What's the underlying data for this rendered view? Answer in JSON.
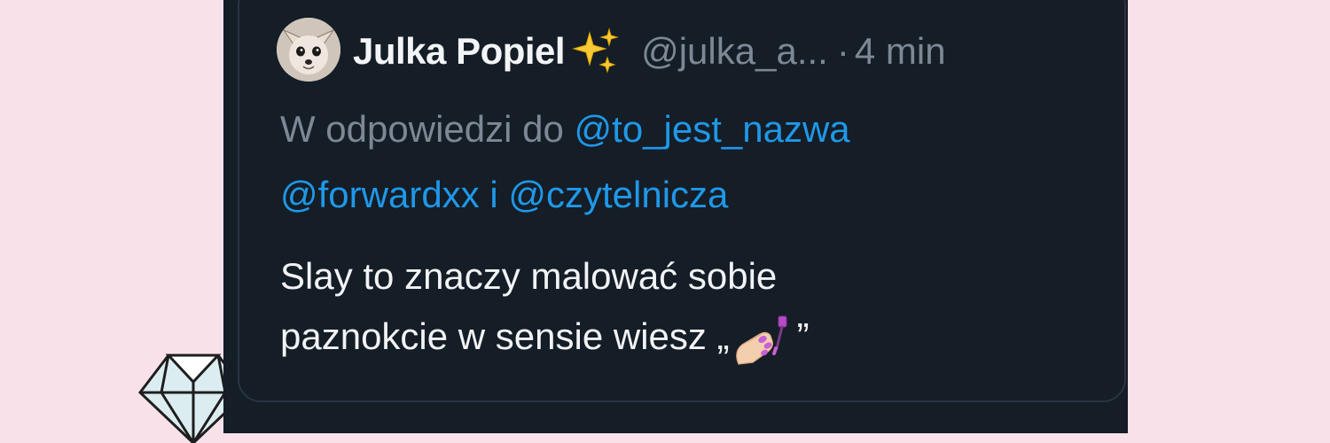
{
  "tweet": {
    "display_name": "Julka Popiel",
    "display_name_icon": "sparkles-icon",
    "handle": "@julka_a...",
    "separator": "·",
    "time": "4 min",
    "reply": {
      "prefix": "W odpowiedzi do",
      "mentions": [
        "@to_jest_nazwa",
        "@forwardxx",
        "@czytelnicza"
      ],
      "joiner": "i"
    },
    "body": {
      "line1": "Slay to znaczy malować sobie",
      "line2_text": "paznokcie w sensie wiesz",
      "open_quote": "„",
      "emoji": "nail-polish-icon",
      "close_quote": "”"
    }
  },
  "colors": {
    "background": "#f9e1ea",
    "card": "#151d27",
    "name_text": "#f2f4f6",
    "muted_text": "#7c8895",
    "link": "#1f98e8"
  }
}
